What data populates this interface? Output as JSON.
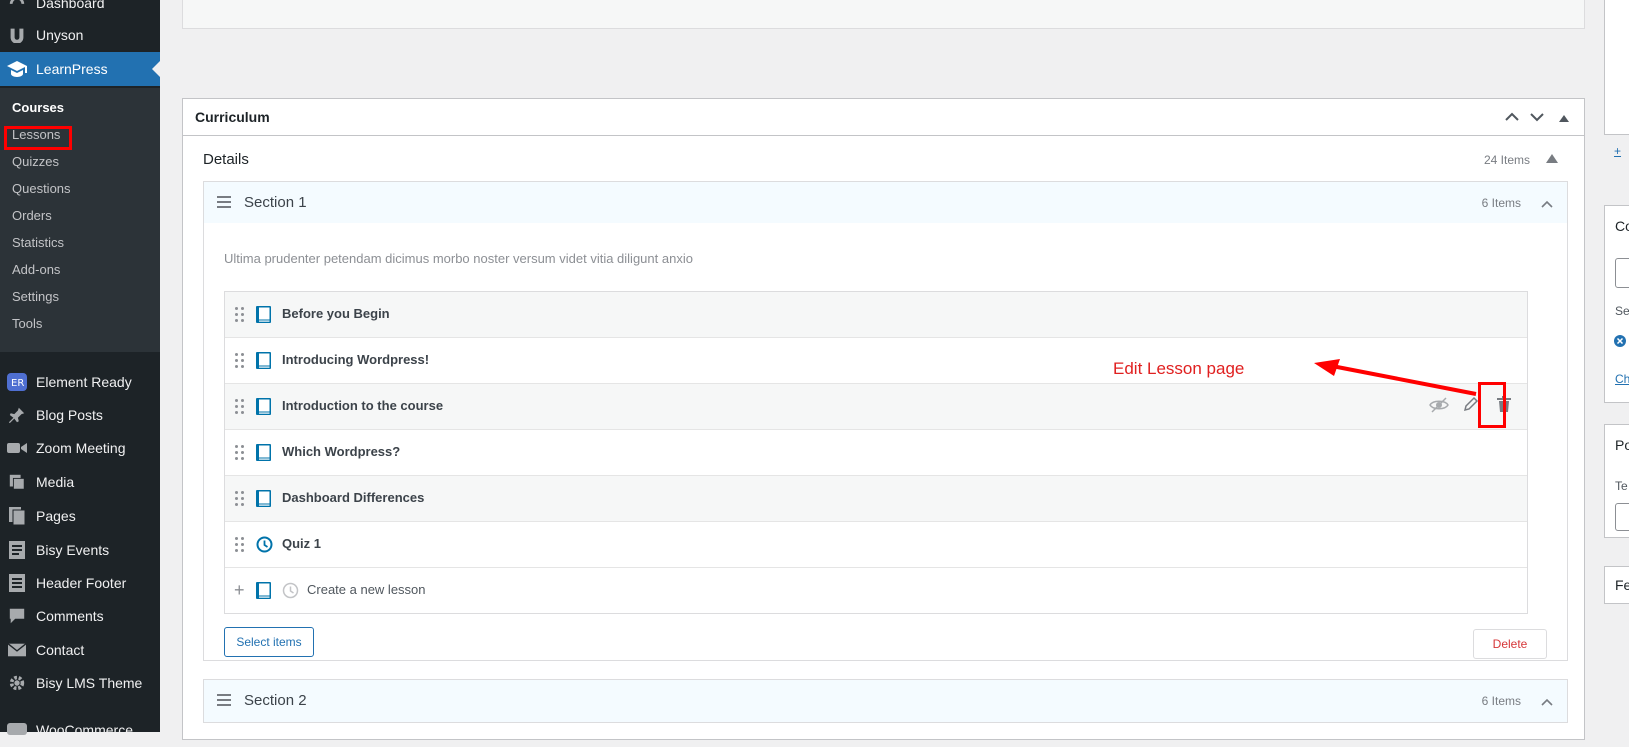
{
  "sidebar": {
    "items": [
      {
        "label": "Dashboard",
        "icon": "dashboard-icon"
      },
      {
        "label": "Unyson",
        "icon": "unyson-icon"
      },
      {
        "label": "LearnPress",
        "icon": "learnpress-cap-icon"
      },
      {
        "label": "Element Ready",
        "icon": "element-ready-icon"
      },
      {
        "label": "Blog Posts",
        "icon": "pin-icon"
      },
      {
        "label": "Zoom Meeting",
        "icon": "video-icon"
      },
      {
        "label": "Media",
        "icon": "media-icon"
      },
      {
        "label": "Pages",
        "icon": "pages-icon"
      },
      {
        "label": "Bisy Events",
        "icon": "events-icon"
      },
      {
        "label": "Header Footer",
        "icon": "header-footer-icon"
      },
      {
        "label": "Comments",
        "icon": "comments-icon"
      },
      {
        "label": "Contact",
        "icon": "envelope-icon"
      },
      {
        "label": "Bisy LMS Theme",
        "icon": "gear-icon"
      },
      {
        "label": "WooCommerce",
        "icon": "woocommerce-icon"
      }
    ],
    "submenu": [
      "Courses",
      "Lessons",
      "Quizzes",
      "Questions",
      "Orders",
      "Statistics",
      "Add-ons",
      "Settings",
      "Tools"
    ]
  },
  "curriculum": {
    "title": "Curriculum",
    "details_title": "Details",
    "details_count": "24 Items",
    "sections": [
      {
        "name": "Section 1",
        "count": "6 Items",
        "description": "Ultima prudenter petendam dicimus morbo noster versum videt vitia diligunt anxio",
        "items": [
          {
            "title": "Before you Begin",
            "type": "lesson"
          },
          {
            "title": "Introducing Wordpress!",
            "type": "lesson"
          },
          {
            "title": "Introduction to the course",
            "type": "lesson"
          },
          {
            "title": "Which Wordpress?",
            "type": "lesson"
          },
          {
            "title": "Dashboard Differences",
            "type": "lesson"
          },
          {
            "title": "Quiz 1",
            "type": "quiz"
          }
        ],
        "new_item_placeholder": "Create a new lesson",
        "select_label": "Select items",
        "delete_label": "Delete"
      },
      {
        "name": "Section 2",
        "count": "6 Items"
      }
    ]
  },
  "right_panels": [
    {
      "label": "+"
    },
    {
      "label": "Co"
    },
    {
      "label": "Se"
    },
    {
      "label": "Ch"
    },
    {
      "label": "Po"
    },
    {
      "label": "Te"
    },
    {
      "label": "Fe"
    }
  ],
  "annotation": {
    "text": "Edit Lesson page"
  },
  "colors": {
    "sidebar_bg": "#1d2327",
    "accent": "#2271b1",
    "annotation_red": "#ff0000"
  }
}
